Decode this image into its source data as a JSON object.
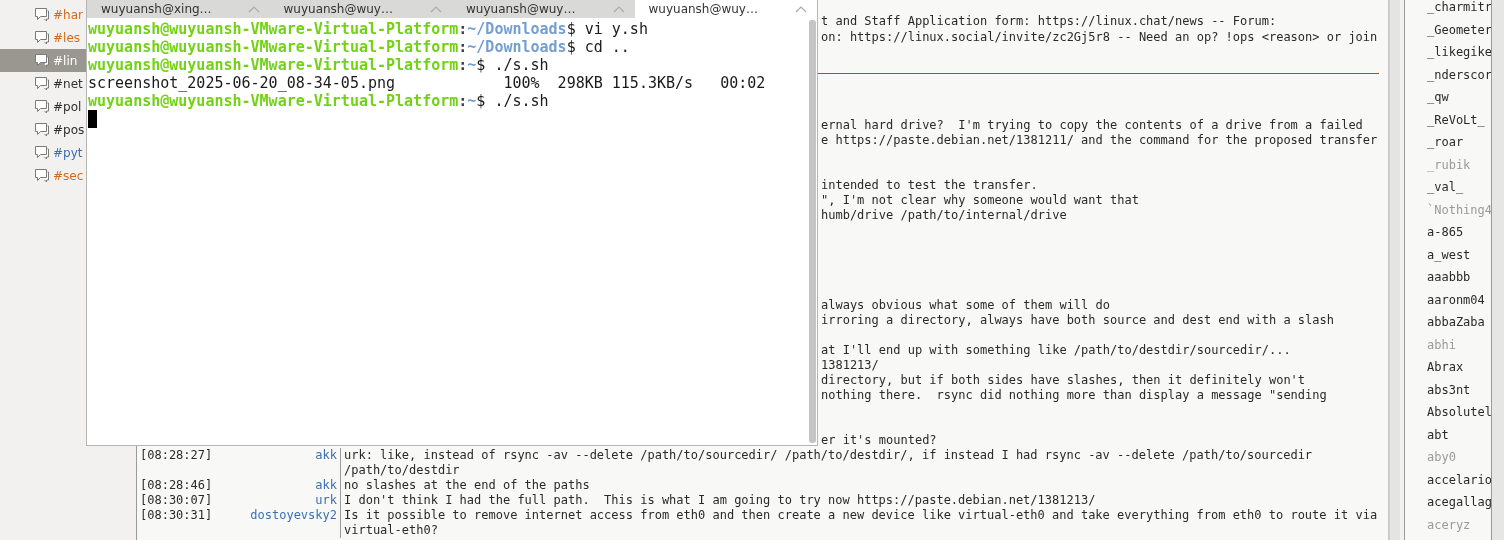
{
  "channels": [
    {
      "name": "#har",
      "color": "#d2691e",
      "selected": false
    },
    {
      "name": "#les",
      "color": "#d2691e",
      "selected": false
    },
    {
      "name": "#lin",
      "color": "#ffffff",
      "selected": true
    },
    {
      "name": "#net",
      "color": "#2e2e2e",
      "selected": false
    },
    {
      "name": "#pol",
      "color": "#2e2e2e",
      "selected": false
    },
    {
      "name": "#pos",
      "color": "#2e2e2e",
      "selected": false
    },
    {
      "name": "#pyt",
      "color": "#3b6fb6",
      "selected": false
    },
    {
      "name": "#sec",
      "color": "#d2691e",
      "selected": false
    }
  ],
  "topic": [
    "t and Staff Application form: https://linux.chat/news -- Forum:",
    "on: https://linux.social/invite/zc2Gj5r8 -- Need an op? !ops <reason> or join"
  ],
  "partial_lines": [
    [
      "ernal hard drive?  I'm trying to copy the contents of a drive from a failed",
      "e https://paste.debian.net/1381211/ and the command for the proposed transfer"
    ],
    [
      "intended to test the transfer.",
      "\", I'm not clear why someone would want that",
      "humb/drive /path/to/internal/drive"
    ],
    [
      "always obvious what some of them will do",
      "irroring a directory, always have both source and dest end with a slash"
    ],
    [
      "at I'll end up with something like /path/to/destdir/sourcedir/...",
      "1381213/",
      "directory, but if both sides have slashes, then it definitely won't",
      "nothing there.  rsync did nothing more than display a message \"sending"
    ],
    [
      "er it's mounted?"
    ]
  ],
  "messages": [
    {
      "time": "[08:28:27]",
      "nick": "akk",
      "lines": [
        "urk: like, instead of rsync -av --delete /path/to/sourcedir/ /path/to/destdir/, if instead I had rsync -av --delete /path/to/sourcedir",
        "/path/to/destdir"
      ]
    },
    {
      "time": "[08:28:46]",
      "nick": "akk",
      "lines": [
        "no slashes at the end of the paths"
      ]
    },
    {
      "time": "[08:30:07]",
      "nick": "urk",
      "lines": [
        "I don't think I had the full path.  This is what I am going to try now https://paste.debian.net/1381213/"
      ]
    },
    {
      "time": "[08:30:31]",
      "nick": "dostoyevsky2",
      "lines": [
        "Is it possible to remove internet access from eth0 and then create a new device like virtual-eth0 and take everything from eth0 to route it via",
        "virtual-eth0?"
      ]
    }
  ],
  "users": [
    {
      "nick": "_charmitr",
      "away": false
    },
    {
      "nick": "_Geometer",
      "away": false
    },
    {
      "nick": "_likegike",
      "away": false
    },
    {
      "nick": "_nderscor",
      "away": false
    },
    {
      "nick": "_qw",
      "away": false
    },
    {
      "nick": "_ReVoLt_",
      "away": false
    },
    {
      "nick": "_roar",
      "away": false
    },
    {
      "nick": "_rubik",
      "away": true
    },
    {
      "nick": "_val_",
      "away": false
    },
    {
      "nick": "`Nothing4",
      "away": true
    },
    {
      "nick": "a-865",
      "away": false
    },
    {
      "nick": "a_west",
      "away": false
    },
    {
      "nick": "aaabbb",
      "away": false
    },
    {
      "nick": "aaronm04",
      "away": false
    },
    {
      "nick": "abbaZaba",
      "away": false
    },
    {
      "nick": "abhi",
      "away": true
    },
    {
      "nick": "Abrax",
      "away": false
    },
    {
      "nick": "abs3nt",
      "away": false
    },
    {
      "nick": "Absolutel",
      "away": false
    },
    {
      "nick": "abt",
      "away": false
    },
    {
      "nick": "aby0",
      "away": true
    },
    {
      "nick": "accelario",
      "away": false
    },
    {
      "nick": "acegallag",
      "away": false
    },
    {
      "nick": "aceryz",
      "away": true
    }
  ],
  "terminal": {
    "tabs": [
      {
        "label": "wuyuansh@xing…",
        "selected": false
      },
      {
        "label": "wuyuansh@wuy…",
        "selected": false
      },
      {
        "label": "wuyuansh@wuy…",
        "selected": false
      },
      {
        "label": "wuyuansh@wuy…",
        "selected": true
      }
    ],
    "lines": [
      {
        "kind": "prompt",
        "user_host": "wuyuansh@wuyuansh-VMware-Virtual-Platform",
        "sep": ":",
        "path": "~/Downloads",
        "sign": "$",
        "command": " vi y.sh"
      },
      {
        "kind": "prompt",
        "user_host": "wuyuansh@wuyuansh-VMware-Virtual-Platform",
        "sep": ":",
        "path": "~/Downloads",
        "sign": "$",
        "command": " cd .."
      },
      {
        "kind": "prompt",
        "user_host": "wuyuansh@wuyuansh-VMware-Virtual-Platform",
        "sep": ":",
        "path": "~",
        "sign": "$",
        "command": " ./s.sh"
      },
      {
        "kind": "output",
        "text": "screenshot_2025-06-20_08-34-05.png            100%  298KB 115.3KB/s   00:02"
      },
      {
        "kind": "prompt",
        "user_host": "wuyuansh@wuyuansh-VMware-Virtual-Platform",
        "sep": ":",
        "path": "~",
        "sign": "$",
        "command": " ./s.sh"
      }
    ],
    "cursor": true
  }
}
